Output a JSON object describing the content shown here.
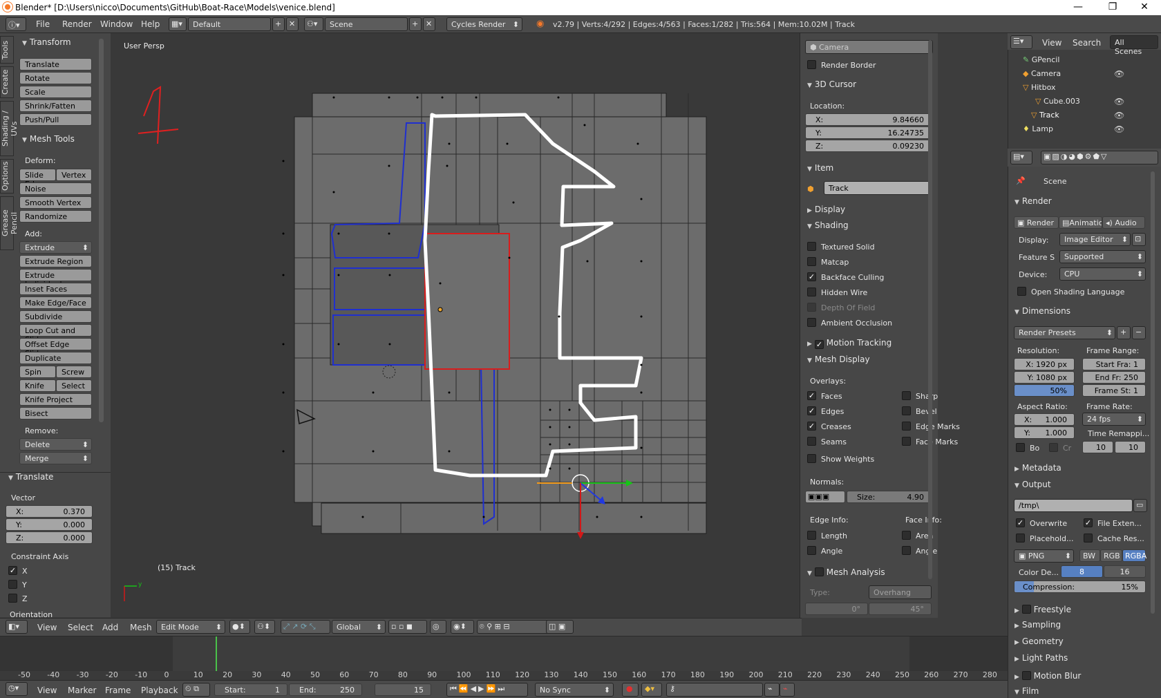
{
  "window": {
    "title": "Blender* [D:\\Users\\nicco\\Documents\\GitHub\\Boat-Race\\Models\\venice.blend]"
  },
  "info": {
    "menus": [
      "File",
      "Render",
      "Window",
      "Help"
    ],
    "layout": "Default",
    "scene": "Scene",
    "engine": "Cycles Render",
    "stats": "v2.79 | Verts:4/292 | Edges:4/563 | Faces:1/282 | Tris:564 | Mem:10.02M | Track"
  },
  "toolshelf": {
    "tabs": [
      "Tools",
      "Create",
      "Shading / UVs",
      "Options",
      "Grease Pencil"
    ],
    "transform_title": "Transform",
    "transform": [
      "Translate",
      "Rotate",
      "Scale",
      "Shrink/Fatten",
      "Push/Pull"
    ],
    "meshtools_title": "Mesh Tools",
    "deform_label": "Deform:",
    "slide_edge": "Slide Ed",
    "vertex": "Vertex",
    "deform": [
      "Noise",
      "Smooth Vertex",
      "Randomize"
    ],
    "add_label": "Add:",
    "extrude": "Extrude",
    "add": [
      "Extrude Region",
      "Extrude Individual",
      "Inset Faces",
      "Make Edge/Face",
      "Subdivide",
      "Loop Cut and Slide",
      "Offset Edge Slide",
      "Duplicate"
    ],
    "spin": "Spin",
    "screw": "Screw",
    "knife": "Knife",
    "select": "Select",
    "knife_project": "Knife Project",
    "bisect": "Bisect",
    "remove_label": "Remove:",
    "delete": "Delete",
    "merge": "Merge"
  },
  "operator": {
    "title": "Translate",
    "vector_label": "Vector",
    "x_label": "X:",
    "x": "0.370",
    "y_label": "Y:",
    "y": "0.000",
    "z_label": "Z:",
    "z": "0.000",
    "constraint_label": "Constraint Axis",
    "axes": [
      "X",
      "Y",
      "Z"
    ],
    "orientation_label": "Orientation"
  },
  "viewport": {
    "view_name": "User Persp",
    "object_info": "(15) Track",
    "annotation": "1"
  },
  "view_header": {
    "menus": [
      "View",
      "Select",
      "Add",
      "Mesh"
    ],
    "mode": "Edit Mode",
    "orientation": "Global"
  },
  "npanel": {
    "camera_placeholder": "Camera",
    "render_border": "Render Border",
    "cursor_title": "3D Cursor",
    "location_label": "Location:",
    "cx_label": "X:",
    "cx": "9.84660",
    "cy_label": "Y:",
    "cy": "16.24735",
    "cz_label": "Z:",
    "cz": "0.09230",
    "item_title": "Item",
    "item_name": "Track",
    "display_title": "Display",
    "shading_title": "Shading",
    "shading": [
      {
        "label": "Textured Solid",
        "checked": false
      },
      {
        "label": "Matcap",
        "checked": false
      },
      {
        "label": "Backface Culling",
        "checked": true
      },
      {
        "label": "Hidden Wire",
        "checked": false
      },
      {
        "label": "Depth Of Field",
        "checked": false
      },
      {
        "label": "Ambient Occlusion",
        "checked": false
      }
    ],
    "motion_tracking": "Motion Tracking",
    "mesh_display_title": "Mesh Display",
    "overlays_label": "Overlays:",
    "overlays_left": [
      {
        "label": "Faces",
        "checked": true
      },
      {
        "label": "Edges",
        "checked": true
      },
      {
        "label": "Creases",
        "checked": true
      },
      {
        "label": "Seams",
        "checked": false
      }
    ],
    "overlays_right": [
      {
        "label": "Sharp",
        "checked": false
      },
      {
        "label": "Bevel",
        "checked": false
      },
      {
        "label": "Edge Marks",
        "checked": false
      },
      {
        "label": "Face Marks",
        "checked": false
      }
    ],
    "show_weights": "Show Weights",
    "normals_label": "Normals:",
    "size_label": "Size:",
    "size": "4.90",
    "edge_info": "Edge Info:",
    "face_info": "Face Info:",
    "length": "Length",
    "edge_angle": "Angle",
    "area": "Area",
    "face_angle": "Angle",
    "mesh_analysis": "Mesh Analysis",
    "type_label": "Type:",
    "type_value": "Overhang",
    "angle_min": "0°",
    "angle_max": "45°"
  },
  "outliner": {
    "view": "View",
    "search": "Search",
    "all_scenes": "All Scenes",
    "items": [
      "GPencil",
      "Camera",
      "Hitbox",
      "Cube.003",
      "Track",
      "Lamp"
    ]
  },
  "properties": {
    "scene_label": "Scene",
    "render_title": "Render",
    "render_btns": [
      "Render",
      "Animatio",
      "Audio"
    ],
    "display_label": "Display:",
    "display_value": "Image Editor",
    "feature_label": "Feature S",
    "feature_value": "Supported",
    "device_label": "Device:",
    "device_value": "CPU",
    "osl": "Open Shading Language",
    "dimensions_title": "Dimensions",
    "presets": "Render Presets",
    "resolution_label": "Resolution:",
    "frame_range_label": "Frame Range:",
    "res_x": "X: 1920 px",
    "res_y": "Y: 1080 px",
    "res_pct": "50%",
    "start_frame": "Start Fra: 1",
    "end_frame": "End Fr: 250",
    "frame_step": "Frame St: 1",
    "aspect_label": "Aspect Ratio:",
    "frame_rate_label": "Frame Rate:",
    "asp_x_label": "X:",
    "asp_x": "1.000",
    "asp_y_label": "Y:",
    "asp_y": "1.000",
    "fps": "24 fps",
    "time_remap": "Time Remappi...",
    "bo": "Bo",
    "cr": "Cr",
    "remap_old": "10",
    "remap_new": "10",
    "metadata_title": "Metadata",
    "output_title": "Output",
    "output_path": "/tmp\\",
    "overwrite": "Overwrite",
    "file_ext": "File Exten...",
    "placeholders": "Placehold...",
    "cache_res": "Cache Res...",
    "format": "PNG",
    "bw": "BW",
    "rgb": "RGB",
    "rgba": "RGBA",
    "color_depth_label": "Color De...",
    "depth8": "8",
    "depth16": "16",
    "compression": "Compression:",
    "compression_value": "15%",
    "collapsed": [
      "Freestyle",
      "Sampling",
      "Geometry",
      "Light Paths",
      "Motion Blur",
      "Film"
    ]
  },
  "timeline": {
    "ticks": [
      "-50",
      "-40",
      "-30",
      "-20",
      "-10",
      "0",
      "10",
      "20",
      "30",
      "40",
      "50",
      "60",
      "70",
      "80",
      "90",
      "100",
      "110",
      "120",
      "130",
      "140",
      "150",
      "160",
      "170",
      "180",
      "190",
      "200",
      "210",
      "220",
      "230",
      "240",
      "250",
      "260",
      "270",
      "280"
    ],
    "menus": [
      "View",
      "Marker",
      "Frame",
      "Playback"
    ],
    "start_label": "Start:",
    "start": "1",
    "end_label": "End:",
    "end": "250",
    "current": "15",
    "sync": "No Sync"
  }
}
